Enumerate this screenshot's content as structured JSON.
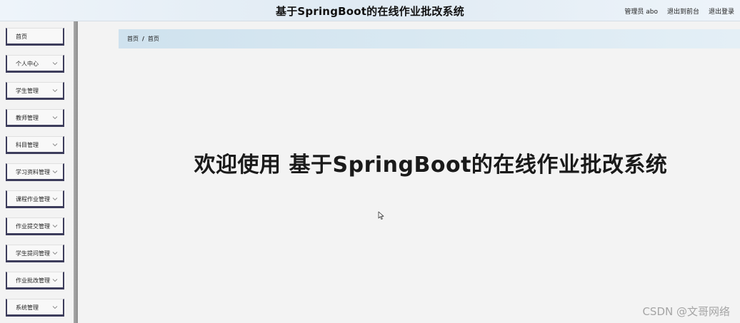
{
  "header": {
    "title": "基于SpringBoot的在线作业批改系统",
    "admin_label": "管理员 abo",
    "exit_to_front": "退出到前台",
    "logout": "退出登录"
  },
  "sidebar": {
    "items": [
      {
        "label": "首页",
        "has_chevron": false
      },
      {
        "label": "个人中心",
        "has_chevron": true
      },
      {
        "label": "学生管理",
        "has_chevron": true
      },
      {
        "label": "教师管理",
        "has_chevron": true
      },
      {
        "label": "科目管理",
        "has_chevron": true
      },
      {
        "label": "学习资料管理",
        "has_chevron": true
      },
      {
        "label": "课程作业管理",
        "has_chevron": true
      },
      {
        "label": "作业提交管理",
        "has_chevron": true
      },
      {
        "label": "学生提问管理",
        "has_chevron": true
      },
      {
        "label": "作业批改管理",
        "has_chevron": true
      },
      {
        "label": "系统管理",
        "has_chevron": true
      }
    ]
  },
  "breadcrumb": {
    "home": "首页",
    "separator": "/",
    "current": "首页"
  },
  "main": {
    "welcome_text": "欢迎使用 基于SpringBoot的在线作业批改系统"
  },
  "watermark": "CSDN @文哥网络",
  "colors": {
    "sidebar_border": "#3d3d5c",
    "breadcrumb_bg": "#cfe2ee",
    "background": "#f3f3f3"
  }
}
